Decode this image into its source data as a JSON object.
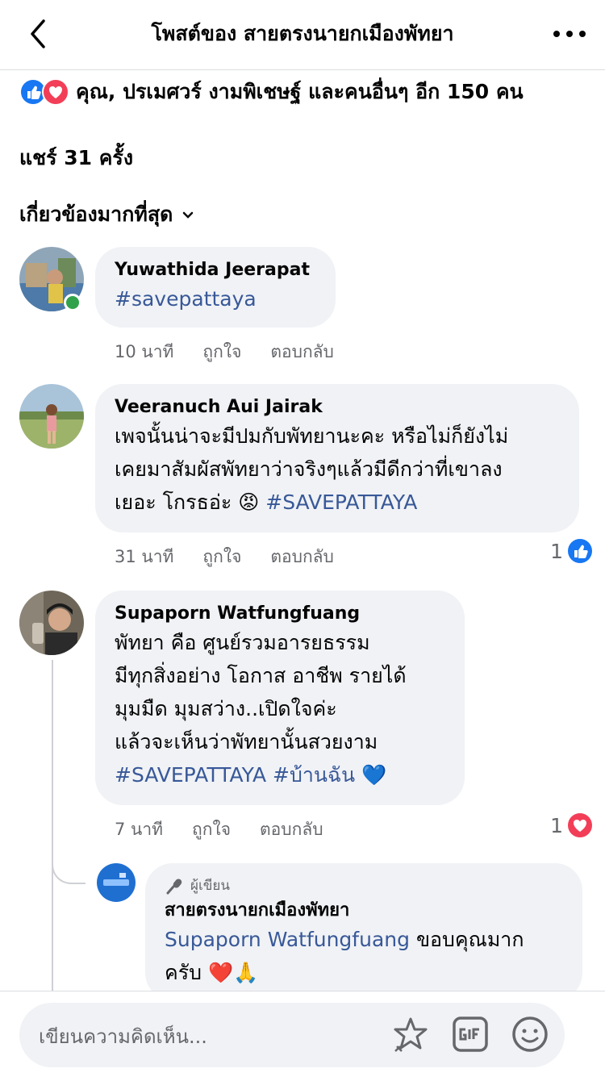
{
  "header": {
    "title": "โพสต์ของ สายตรงนายกเมืองพัทยา"
  },
  "reactions": {
    "summary": "คุณ, ปรเมศวร์ งามพิเชษฐ์ และคนอื่นๆ อีก 150 คน"
  },
  "shares": {
    "label": "แชร์ 31 ครั้ง"
  },
  "sort": {
    "label": "เกี่ยวข้องมากที่สุด"
  },
  "comments": [
    {
      "name": "Yuwathida Jeerapat",
      "text": "",
      "hashtags": "#savepattaya",
      "time": "10 นาที",
      "like_label": "ถูกใจ",
      "reply_label": "ตอบกลับ",
      "online": true
    },
    {
      "name": "Veeranuch Aui Jairak",
      "line1": "เพจนั้นน่าจะมีปมกับพัทยานะคะ หรือไม่ก็ยังไม่",
      "line2": "เคยมาสัมผัสพัทยาว่าจริงๆแล้วมีดีกว่าที่เขาลง",
      "line3": "เยอะ โกรธอ่ะ",
      "emoji": "😡",
      "hashtags": "#SAVEPATTAYA",
      "time": "31 นาที",
      "like_label": "ถูกใจ",
      "reply_label": "ตอบกลับ",
      "reaction_count": "1",
      "reaction_type": "like"
    },
    {
      "name": "Supaporn Watfungfuang",
      "line1": "พัทยา คือ ศูนย์รวมอารยธรรม",
      "line2": "มีทุกสิ่งอย่าง โอกาส อาชีพ รายได้",
      "line3": "มุมมืด มุมสว่าง..เปิดใจค่ะ",
      "line4": "แล้วจะเห็นว่าพัทยานั้นสวยงาม",
      "hashtags": "#SAVEPATTAYA #บ้านฉัน",
      "emoji": "💙",
      "time": "7 นาที",
      "like_label": "ถูกใจ",
      "reply_label": "ตอบกลับ",
      "reaction_count": "1",
      "reaction_type": "love"
    }
  ],
  "reply": {
    "author_badge": "ผู้เขียน",
    "name": "สายตรงนายกเมืองพัทยา",
    "mention": "Supaporn Watfungfuang",
    "text1": "ขอบคุณมาก",
    "text2": "ครับ",
    "emoji": "❤️🙏"
  },
  "composer": {
    "placeholder": "เขียนความคิดเห็น..."
  },
  "colors": {
    "like_blue": "#1877f2",
    "love_red": "#f33e58",
    "link": "#385898",
    "bubble": "#f0f2f5"
  }
}
